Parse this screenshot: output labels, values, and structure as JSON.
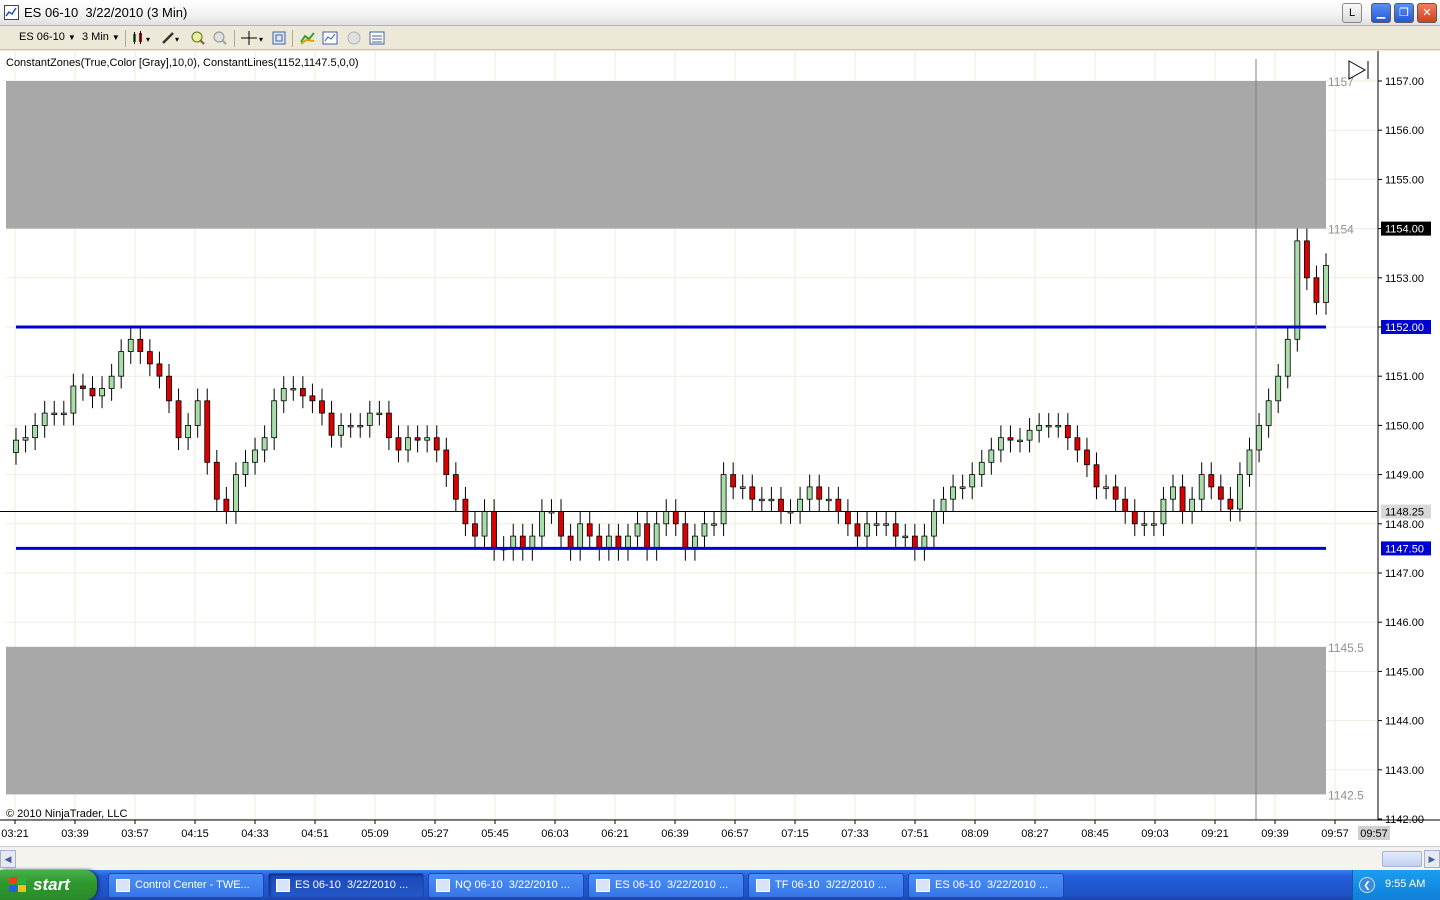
{
  "window": {
    "title": "ES 06-10  3/22/2010 (3 Min)",
    "buttons": {
      "l_label": "L",
      "minimize": "▁",
      "maximize": "❐",
      "close": "✕"
    }
  },
  "toolbar": {
    "instrument": "ES 06-10",
    "interval": "3 Min",
    "icons": [
      "candlestick-style-icon",
      "pencil-draw-icon",
      "zoom-in-icon",
      "zoom-out-icon",
      "crosshair-icon",
      "properties-icon",
      "indicators-icon",
      "strategies-icon",
      "chart-trader-icon",
      "data-box-icon"
    ]
  },
  "chart": {
    "indicator_label": "ConstantZones(True,Color [Gray],10,0), ConstantLines(1152,1147.5,0,0)",
    "copyright": "© 2010 NinjaTrader, LLC",
    "zone_labels": [
      "1157",
      "1154",
      "1145.5",
      "1142.5"
    ],
    "price_labels": {
      "line_high": "1152.00",
      "line_low": "1147.50",
      "last": "1154.00",
      "crosshair": "1148.25",
      "time_marker": "09:57"
    },
    "colors": {
      "zone": "#a8a8a8",
      "lines": "#0000d0",
      "up": "#a8dca8",
      "down": "#dd0000",
      "grid": "#ededdf"
    }
  },
  "chart_data": {
    "type": "candlestick",
    "instrument": "ES 06-10",
    "date": "3/22/2010",
    "interval": "3 Min",
    "y_ticks": [
      "1157.00",
      "1156.00",
      "1155.00",
      "1154.00",
      "1153.00",
      "1152.00",
      "1151.00",
      "1150.00",
      "1149.00",
      "1148.00",
      "1147.00",
      "1146.00",
      "1145.00",
      "1144.00",
      "1143.00",
      "1142.00"
    ],
    "x_ticks": [
      "03:21",
      "03:39",
      "03:57",
      "04:15",
      "04:33",
      "04:51",
      "05:09",
      "05:27",
      "05:45",
      "06:03",
      "06:21",
      "06:39",
      "06:57",
      "07:15",
      "07:33",
      "07:51",
      "08:09",
      "08:27",
      "08:45",
      "09:03",
      "09:21",
      "09:39",
      "09:57"
    ],
    "ylim": [
      1142,
      1157.5
    ],
    "constant_lines": [
      1152,
      1147.5
    ],
    "zones": [
      {
        "from": 1154,
        "to": 1157
      },
      {
        "from": 1142.5,
        "to": 1145.5
      }
    ],
    "crosshair_price": 1148.25,
    "close_series": [
      1149.7,
      1149.75,
      1150,
      1150.25,
      1150.25,
      1150.25,
      1150.8,
      1150.75,
      1150.6,
      1150.75,
      1151,
      1151.5,
      1151.75,
      1151.5,
      1151.25,
      1151,
      1150.5,
      1149.75,
      1150,
      1150.5,
      1149.25,
      1148.5,
      1148.25,
      1149,
      1149.25,
      1149.5,
      1149.75,
      1150.5,
      1150.75,
      1150.75,
      1150.6,
      1150.5,
      1150.25,
      1149.8,
      1150,
      1150,
      1150,
      1150.25,
      1150.25,
      1149.75,
      1149.5,
      1149.75,
      1149.7,
      1149.75,
      1149.5,
      1149,
      1148.5,
      1148,
      1147.75,
      1148.25,
      1147.5,
      1147.5,
      1147.75,
      1147.5,
      1147.75,
      1148.25,
      1148.25,
      1147.75,
      1147.5,
      1148,
      1147.75,
      1147.5,
      1147.75,
      1147.5,
      1147.75,
      1148,
      1147.5,
      1148,
      1148.25,
      1148,
      1147.5,
      1147.75,
      1148,
      1148,
      1149,
      1148.75,
      1148.75,
      1148.5,
      1148.5,
      1148.5,
      1148.25,
      1148.25,
      1148.5,
      1148.75,
      1148.5,
      1148.5,
      1148.25,
      1148,
      1147.75,
      1148,
      1148,
      1148,
      1147.75,
      1147.75,
      1147.5,
      1147.75,
      1148.25,
      1148.5,
      1148.75,
      1148.75,
      1149,
      1149.25,
      1149.5,
      1149.75,
      1149.7,
      1149.7,
      1149.9,
      1150,
      1150,
      1150,
      1149.75,
      1149.5,
      1149.2,
      1148.75,
      1148.75,
      1148.5,
      1148.25,
      1148,
      1148,
      1148,
      1148.5,
      1148.75,
      1148.25,
      1148.5,
      1149,
      1148.75,
      1148.5,
      1148.3,
      1149,
      1149.5,
      1150,
      1150.5,
      1151,
      1151.75,
      1153.75,
      1153,
      1152.5,
      1153.25
    ]
  }
}
